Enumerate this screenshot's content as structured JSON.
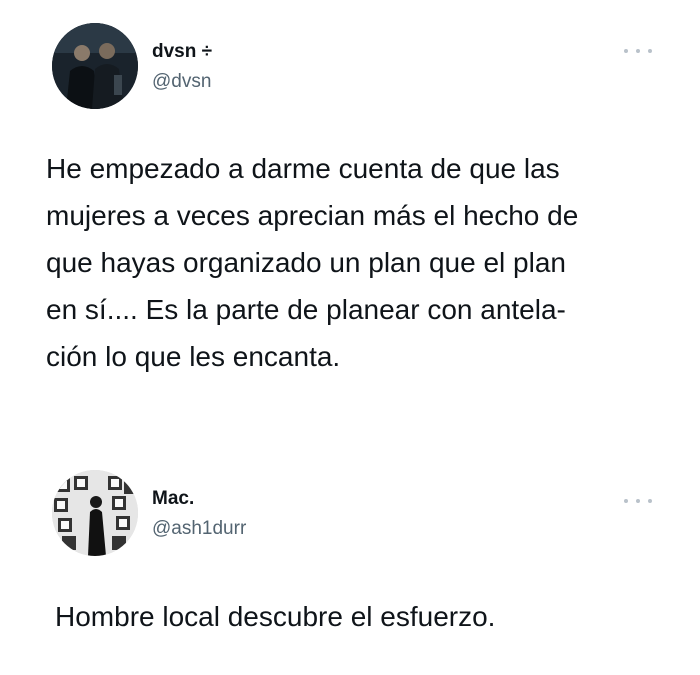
{
  "tweets": [
    {
      "display_name": "dvsn",
      "name_suffix": "÷",
      "handle": "@dvsn",
      "text_lines": [
        "He empezado a darme cuenta de que las",
        "mujeres a veces aprecian más el hecho de",
        "que hayas organizado un plan que el plan",
        "en sí.... Es la parte de planear con antela-",
        "ción lo que les encanta."
      ],
      "avatar_icon": "avatar-two-men-photo"
    },
    {
      "display_name": "Mac.",
      "handle": "@ash1durr",
      "text": "Hombre local descubre el esfuerzo.",
      "avatar_icon": "avatar-gallery-wall-photo"
    }
  ],
  "more_icon": "more-options-icon"
}
